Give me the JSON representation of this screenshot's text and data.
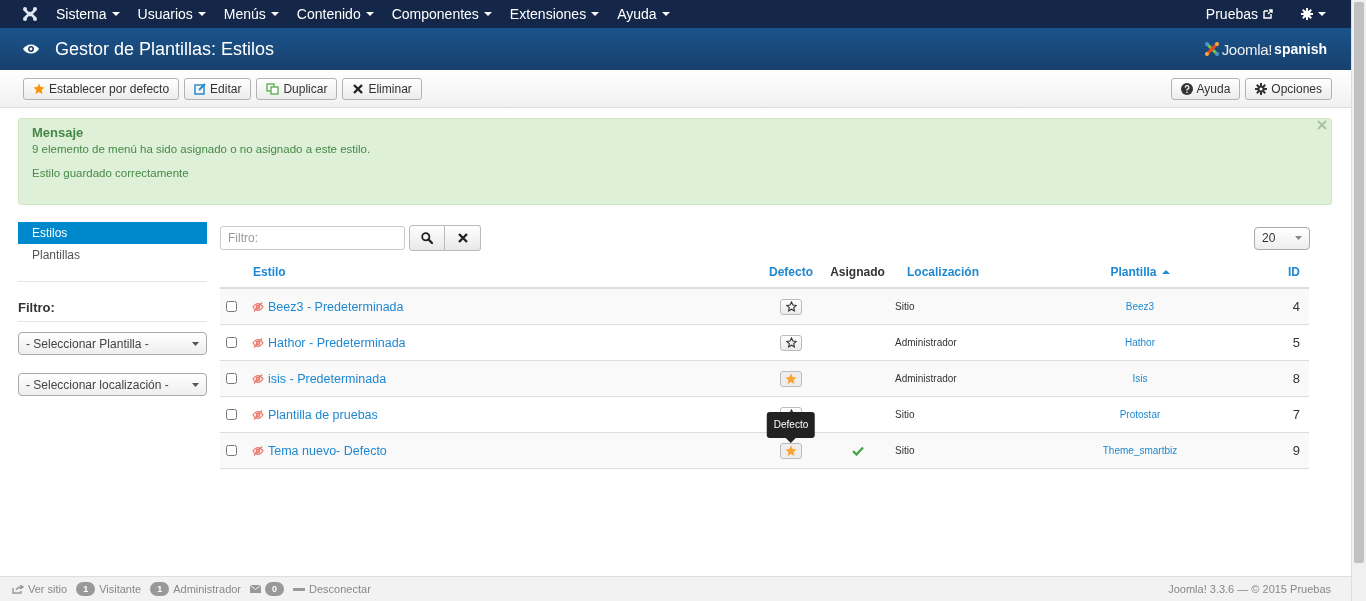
{
  "menu": {
    "items": [
      {
        "label": "Sistema"
      },
      {
        "label": "Usuarios"
      },
      {
        "label": "Menús"
      },
      {
        "label": "Contenido"
      },
      {
        "label": "Componentes"
      },
      {
        "label": "Extensiones"
      },
      {
        "label": "Ayuda"
      }
    ],
    "site_link": "Pruebas"
  },
  "header": {
    "title": "Gestor de Plantillas: Estilos",
    "logo_brand": "Joomla!",
    "logo_language": "spanish"
  },
  "toolbar": {
    "left": [
      {
        "kind": "default",
        "label": "Establecer por defecto"
      },
      {
        "kind": "edit",
        "label": "Editar"
      },
      {
        "kind": "duplicate",
        "label": "Duplicar"
      },
      {
        "kind": "delete",
        "label": "Eliminar"
      }
    ],
    "right": [
      {
        "kind": "help",
        "label": "Ayuda"
      },
      {
        "kind": "options",
        "label": "Opciones"
      }
    ]
  },
  "message": {
    "heading": "Mensaje",
    "lines": [
      "9 elemento de menú ha sido asignado o no asignado a este estilo.",
      "Estilo guardado correctamente"
    ]
  },
  "sidebar": {
    "items": [
      {
        "label": "Estilos",
        "selected": true
      },
      {
        "label": "Plantillas",
        "selected": false
      }
    ],
    "filter_heading": "Filtro:",
    "selects": [
      "- Seleccionar Plantilla -",
      "- Seleccionar localización -"
    ]
  },
  "search": {
    "placeholder": "Filtro:"
  },
  "page_size": "20",
  "table": {
    "columns": [
      {
        "kind": "link",
        "label": "Estilo",
        "sorted": false
      },
      {
        "kind": "link",
        "label": "Defecto",
        "sorted": false
      },
      {
        "kind": "plain",
        "label": "Asignado",
        "sorted": false
      },
      {
        "kind": "link",
        "label": "Localización",
        "sorted": false
      },
      {
        "kind": "link",
        "label": "Plantilla",
        "sorted": true
      },
      {
        "kind": "link",
        "label": "ID",
        "sorted": false
      }
    ],
    "rows": [
      {
        "checked": false,
        "name": "Beez3 - Predeterminada",
        "default": false,
        "assigned": false,
        "location": "Sitio",
        "template": "Beez3",
        "id": "4"
      },
      {
        "checked": false,
        "name": "Hathor - Predeterminada",
        "default": false,
        "assigned": false,
        "location": "Administrador",
        "template": "Hathor",
        "id": "5"
      },
      {
        "checked": false,
        "name": "isis - Predeterminada",
        "default": true,
        "assigned": false,
        "location": "Administrador",
        "template": "Isis",
        "id": "8"
      },
      {
        "checked": false,
        "name": "Plantilla de pruebas",
        "default": false,
        "assigned": false,
        "location": "Sitio",
        "template": "Protostar",
        "id": "7"
      },
      {
        "checked": false,
        "name": "Tema nuevo- Defecto",
        "default": true,
        "assigned": true,
        "location": "Sitio",
        "template": "Theme_smartbiz",
        "id": "9",
        "tooltip": "Defecto"
      }
    ]
  },
  "footer": {
    "items": [
      {
        "kind": "link",
        "label": "Ver sitio"
      },
      {
        "kind": "count",
        "count": "1",
        "label": "Visitante"
      },
      {
        "kind": "count",
        "count": "1",
        "label": "Administrador"
      },
      {
        "kind": "mail",
        "count": "0"
      },
      {
        "kind": "logout",
        "label": "Desconectar"
      }
    ],
    "version": "Joomla! 3.3.6  —  © 2015 Pruebas"
  }
}
